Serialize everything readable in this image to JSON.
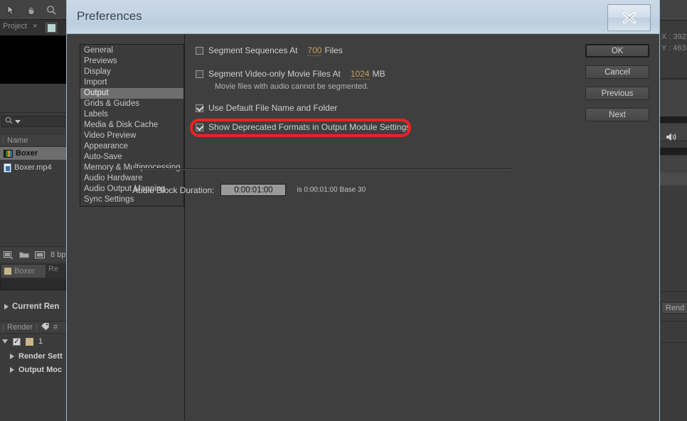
{
  "background": {
    "toolbar_icons": [
      "selection-arrow-icon",
      "hand-icon",
      "zoom-icon"
    ],
    "project_panel": {
      "tab_label": "Project",
      "close_tab": "×",
      "search_placeholder": "",
      "column_header": "Name",
      "items": [
        {
          "label": "Boxer",
          "icon": "composition-icon",
          "selected": true
        },
        {
          "label": "Boxer.mp4",
          "icon": "file-icon",
          "selected": false
        }
      ],
      "footer_bit_depth": "8 bp"
    },
    "render_panel": {
      "tab_a": "Boxer",
      "tab_b": "Re",
      "section_label": "Current Ren",
      "column_render": "Render",
      "row_number": "1",
      "sub_rows": [
        "Render Sett",
        "Output Moc"
      ]
    },
    "right_rail": {
      "coord_x": "X : 392",
      "coord_y": "Y : 463",
      "speaker_icon": "speaker-icon",
      "render_button": "Rend"
    }
  },
  "dialog": {
    "title": "Preferences",
    "close_icon": "close-icon",
    "sidebar": {
      "items": [
        "General",
        "Previews",
        "Display",
        "Import",
        "Output",
        "Grids & Guides",
        "Labels",
        "Media & Disk Cache",
        "Video Preview",
        "Appearance",
        "Auto-Save",
        "Memory & Multiprocessing",
        "Audio Hardware",
        "Audio Output Mapping",
        "Sync Settings"
      ],
      "active_index": 4
    },
    "output": {
      "segment_sequences": {
        "label": "Segment Sequences At",
        "checked": false,
        "value": "700",
        "unit": "Files"
      },
      "segment_video_only": {
        "label": "Segment Video-only Movie Files At",
        "checked": false,
        "value": "1024",
        "unit": "MB"
      },
      "segment_note": "Movie files with audio cannot be segmented.",
      "use_default_file_name": {
        "label": "Use Default File Name and Folder",
        "checked": true
      },
      "show_deprecated_formats": {
        "label": "Show Deprecated Formats in Output Module Settings",
        "checked": true,
        "highlighted": true
      },
      "audio_block_duration": {
        "label": "Audio Block Duration:",
        "value": "0:00:01:00",
        "suffix": "is 0:00:01:00  Base 30"
      }
    },
    "buttons": {
      "ok": "OK",
      "cancel": "Cancel",
      "previous": "Previous",
      "next": "Next"
    }
  },
  "annotation": {
    "color": "#ee2222",
    "target": "show-deprecated-formats-row"
  }
}
